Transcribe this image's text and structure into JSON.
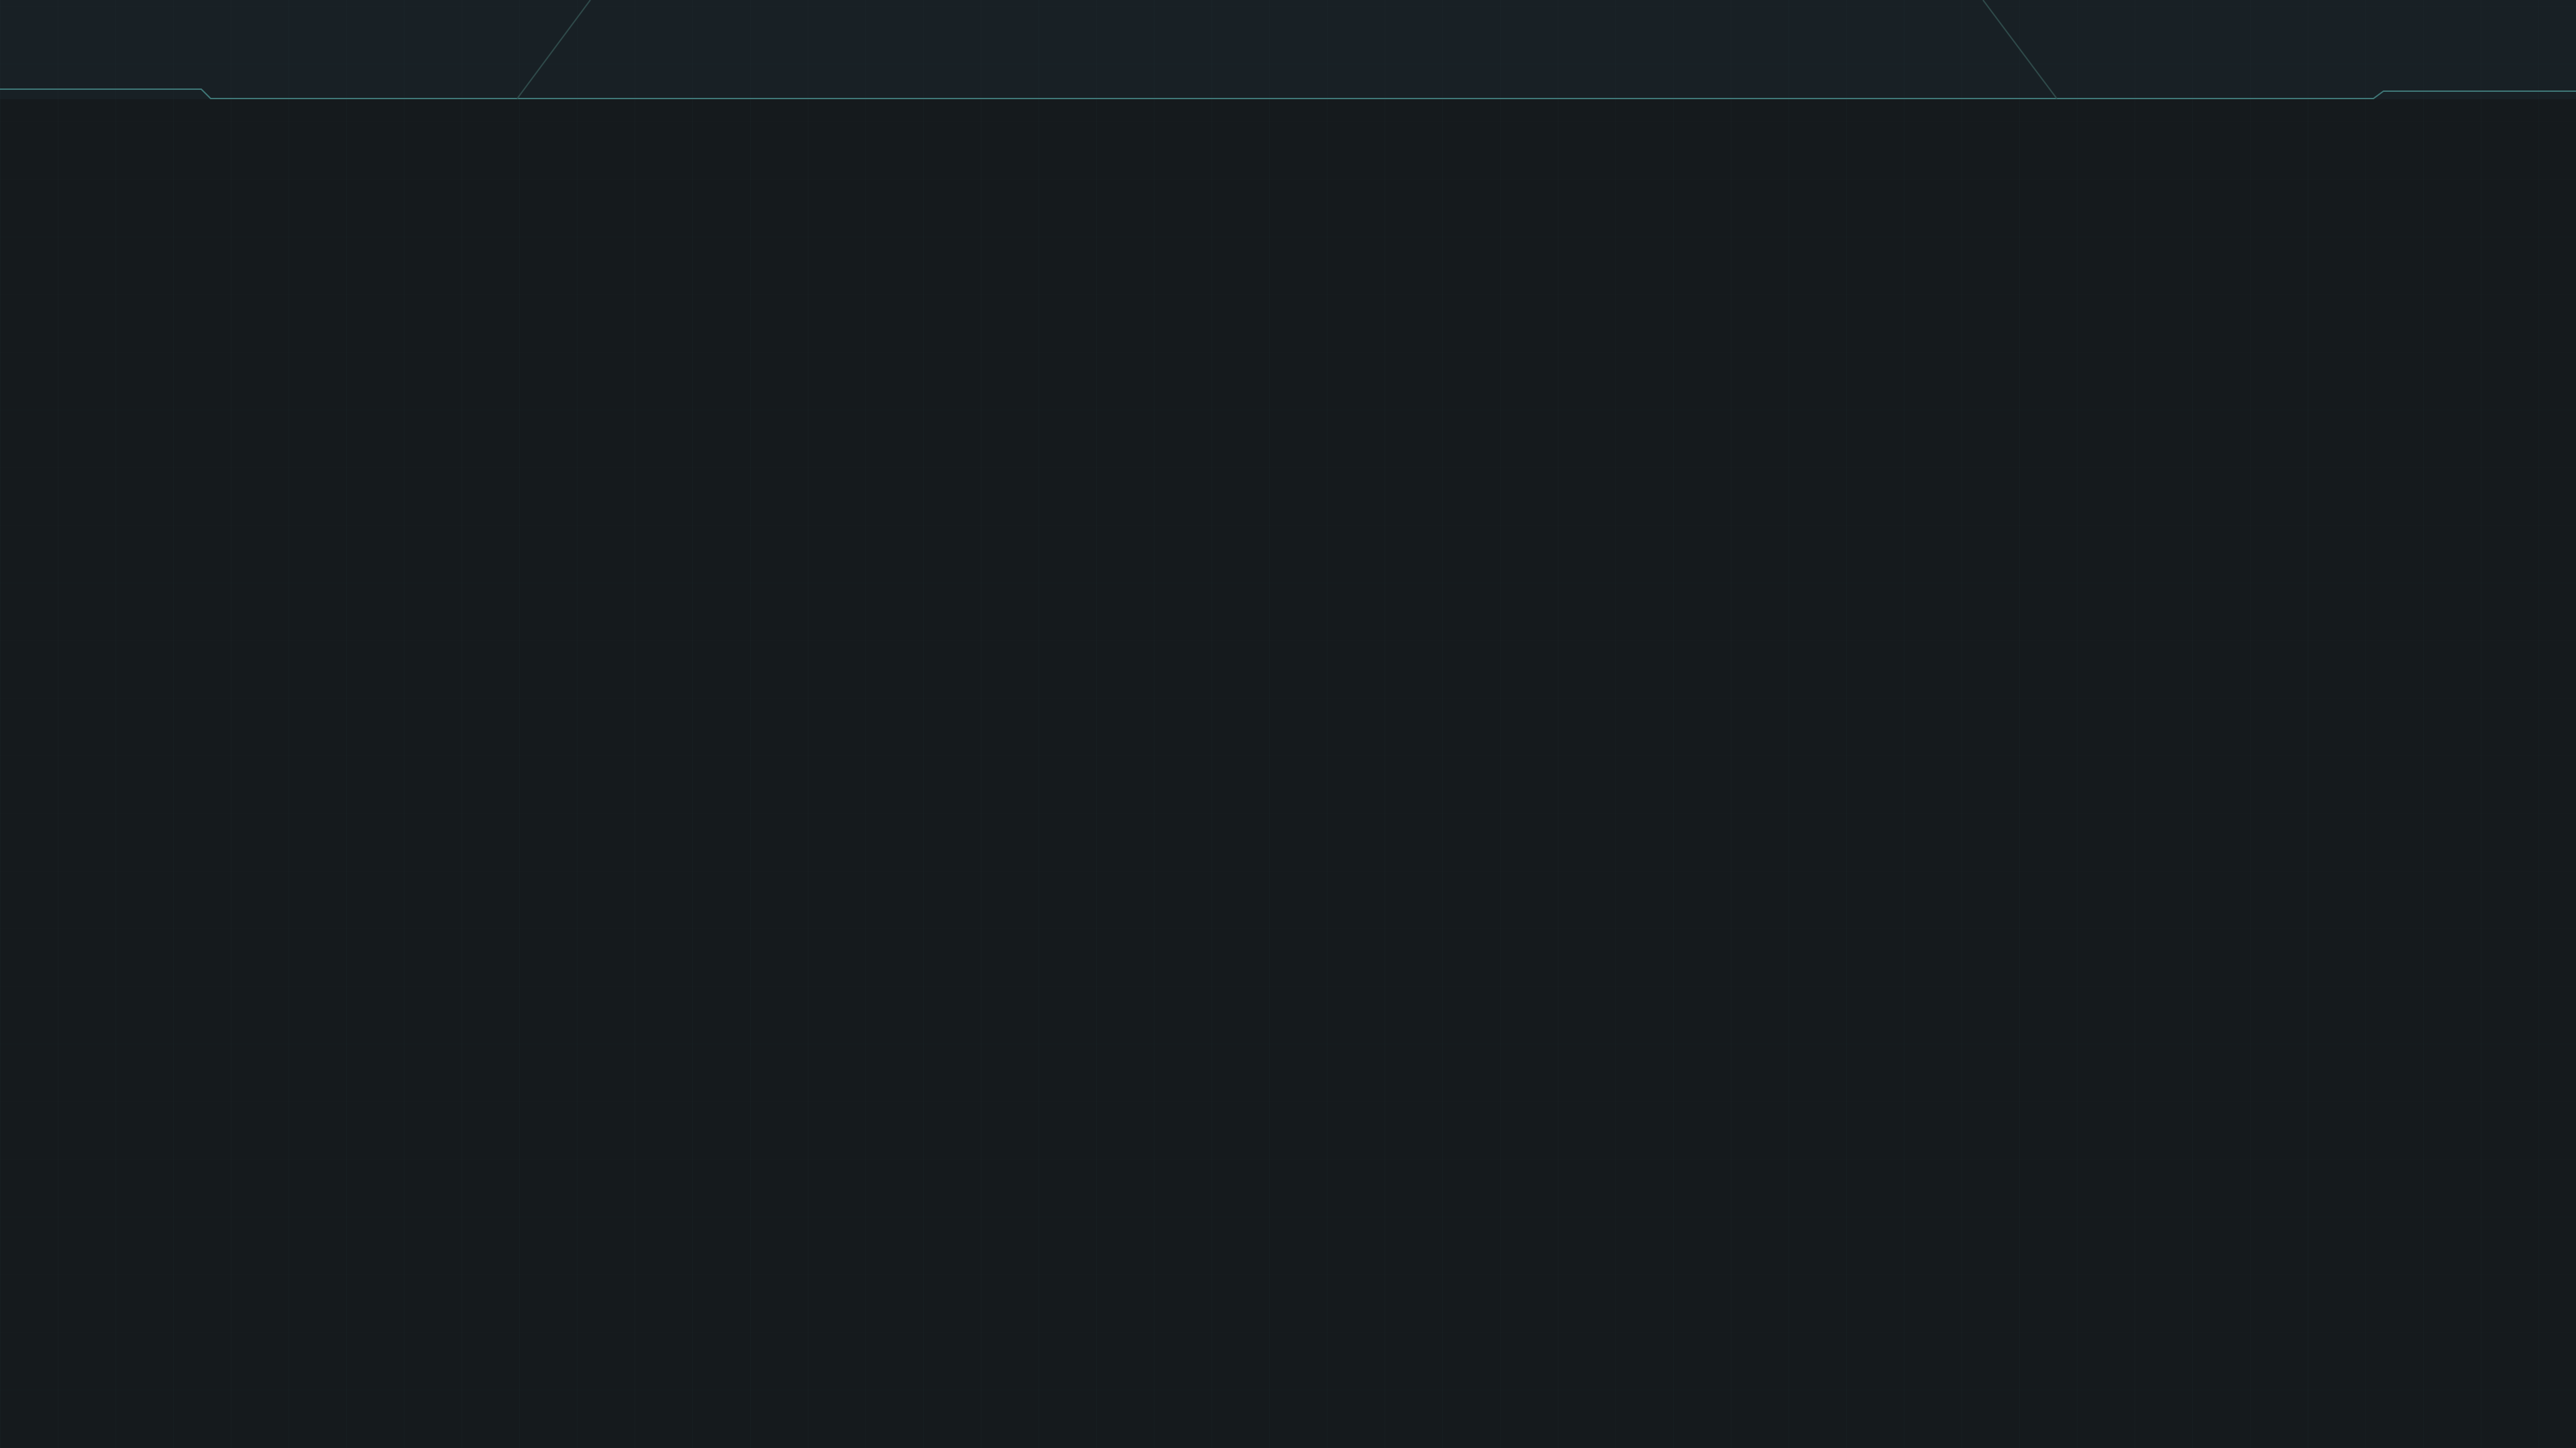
{
  "screen": {
    "background_color": "#151a1d",
    "header_color": "#182025",
    "accent_color": "#3f7777",
    "guide_color": "#2f4a4a"
  }
}
